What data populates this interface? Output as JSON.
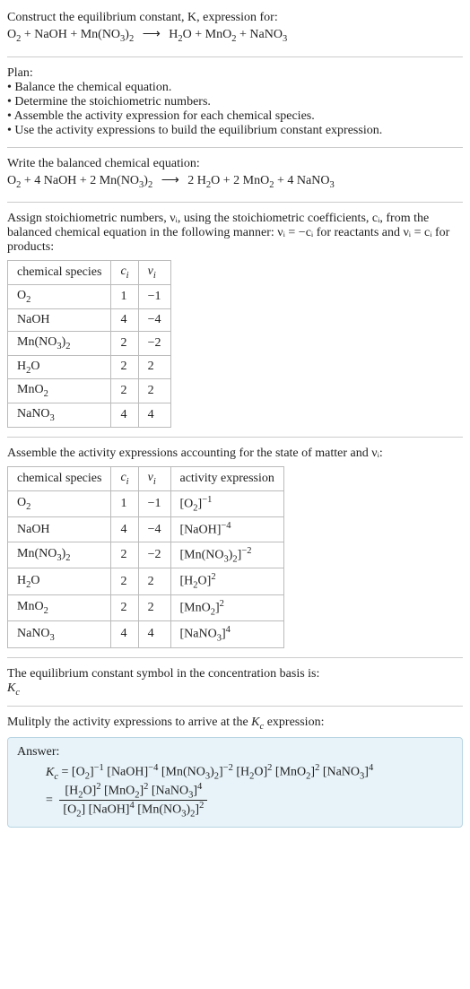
{
  "intro": {
    "line1": "Construct the equilibrium constant, K, expression for:"
  },
  "plan": {
    "heading": "Plan:",
    "b1": "• Balance the chemical equation.",
    "b2": "• Determine the stoichiometric numbers.",
    "b3": "• Assemble the activity expression for each chemical species.",
    "b4": "• Use the activity expressions to build the equilibrium constant expression."
  },
  "balanced_heading": "Write the balanced chemical equation:",
  "stoich": {
    "heading": "Assign stoichiometric numbers, νᵢ, using the stoichiometric coefficients, cᵢ, from the balanced chemical equation in the following manner: νᵢ = −cᵢ for reactants and νᵢ = cᵢ for products:",
    "col_species": "chemical species",
    "col_c": "cᵢ",
    "col_v": "νᵢ",
    "rows": [
      {
        "c": "1",
        "v": "−1"
      },
      {
        "c": "4",
        "v": "−4"
      },
      {
        "c": "2",
        "v": "−2"
      },
      {
        "c": "2",
        "v": "2"
      },
      {
        "c": "2",
        "v": "2"
      },
      {
        "c": "4",
        "v": "4"
      }
    ]
  },
  "activity": {
    "heading": "Assemble the activity expressions accounting for the state of matter and νᵢ:",
    "col_species": "chemical species",
    "col_c": "cᵢ",
    "col_v": "νᵢ",
    "col_a": "activity expression",
    "rows": [
      {
        "c": "1",
        "v": "−1"
      },
      {
        "c": "4",
        "v": "−4"
      },
      {
        "c": "2",
        "v": "−2"
      },
      {
        "c": "2",
        "v": "2"
      },
      {
        "c": "2",
        "v": "2"
      },
      {
        "c": "4",
        "v": "4"
      }
    ]
  },
  "kc_symbol_heading": "The equilibrium constant symbol in the concentration basis is:",
  "kc_symbol": "K",
  "kc_sub": "c",
  "multiply_heading": "Mulitply the activity expressions to arrive at the Kc expression:",
  "answer_label": "Answer:"
}
